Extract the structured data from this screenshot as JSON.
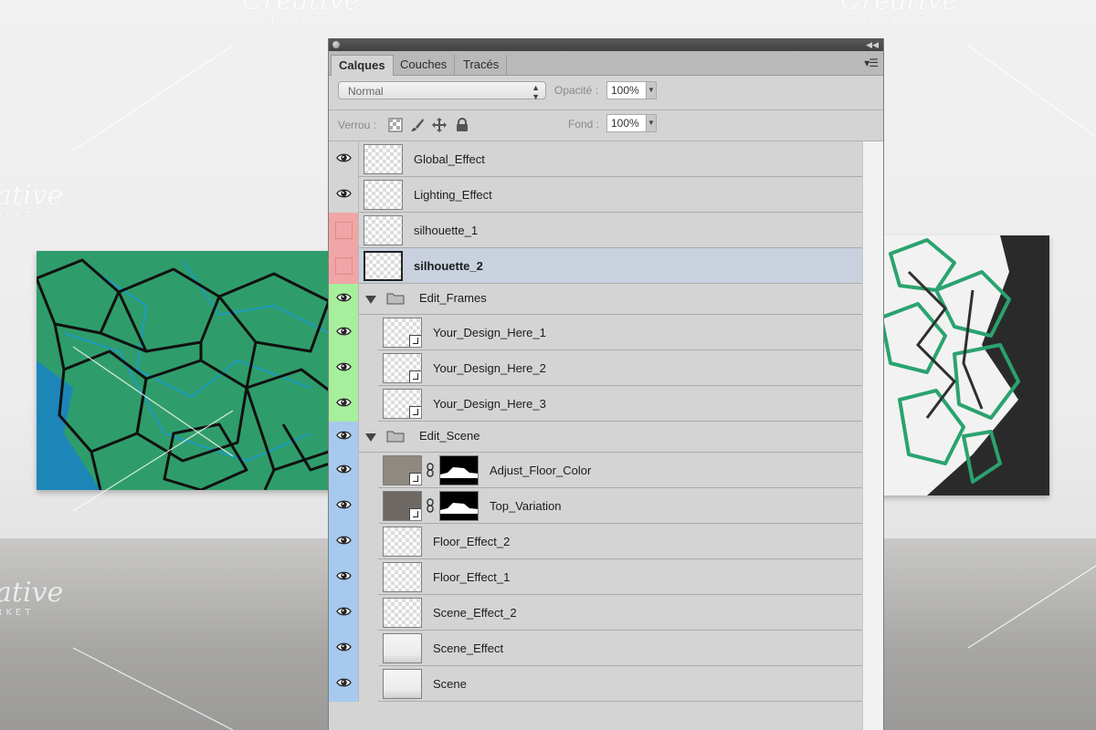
{
  "watermark": {
    "brand": "Creative",
    "sub": "MARKET"
  },
  "panel": {
    "tabs": [
      {
        "label": "Calques",
        "active": true
      },
      {
        "label": "Couches",
        "active": false
      },
      {
        "label": "Tracés",
        "active": false
      }
    ],
    "blend_mode": "Normal",
    "opacity_label": "Opacité :",
    "opacity_value": "100%",
    "lock_label": "Verrou :",
    "fill_label": "Fond :",
    "fill_value": "100%"
  },
  "layers": [
    {
      "name": "Global_Effect",
      "visible": true,
      "color": "none",
      "kind": "layer"
    },
    {
      "name": "Lighting_Effect",
      "visible": true,
      "color": "none",
      "kind": "layer"
    },
    {
      "name": "silhouette_1",
      "visible": false,
      "color": "red",
      "kind": "layer"
    },
    {
      "name": "silhouette_2",
      "visible": false,
      "color": "red",
      "kind": "layer",
      "selected": true
    },
    {
      "name": "Edit_Frames",
      "visible": true,
      "color": "green",
      "kind": "group"
    },
    {
      "name": "Your_Design_Here_1",
      "visible": true,
      "color": "green",
      "kind": "smart"
    },
    {
      "name": "Your_Design_Here_2",
      "visible": true,
      "color": "green",
      "kind": "smart"
    },
    {
      "name": "Your_Design_Here_3",
      "visible": true,
      "color": "green",
      "kind": "smart"
    },
    {
      "name": "Edit_Scene",
      "visible": true,
      "color": "blue",
      "kind": "group"
    },
    {
      "name": "Adjust_Floor_Color",
      "visible": true,
      "color": "blue",
      "kind": "masked"
    },
    {
      "name": "Top_Variation",
      "visible": true,
      "color": "blue",
      "kind": "masked"
    },
    {
      "name": "Floor_Effect_2",
      "visible": true,
      "color": "blue",
      "kind": "layer"
    },
    {
      "name": "Floor_Effect_1",
      "visible": true,
      "color": "blue",
      "kind": "layer"
    },
    {
      "name": "Scene_Effect_2",
      "visible": true,
      "color": "blue",
      "kind": "layer"
    },
    {
      "name": "Scene_Effect",
      "visible": true,
      "color": "blue",
      "kind": "layer"
    },
    {
      "name": "Scene",
      "visible": true,
      "color": "blue",
      "kind": "layer"
    }
  ],
  "colors": {
    "red": "#f0a6a6",
    "green": "#a6ef9c",
    "blue": "#a7c9ee",
    "selected": "#c9d1de"
  }
}
